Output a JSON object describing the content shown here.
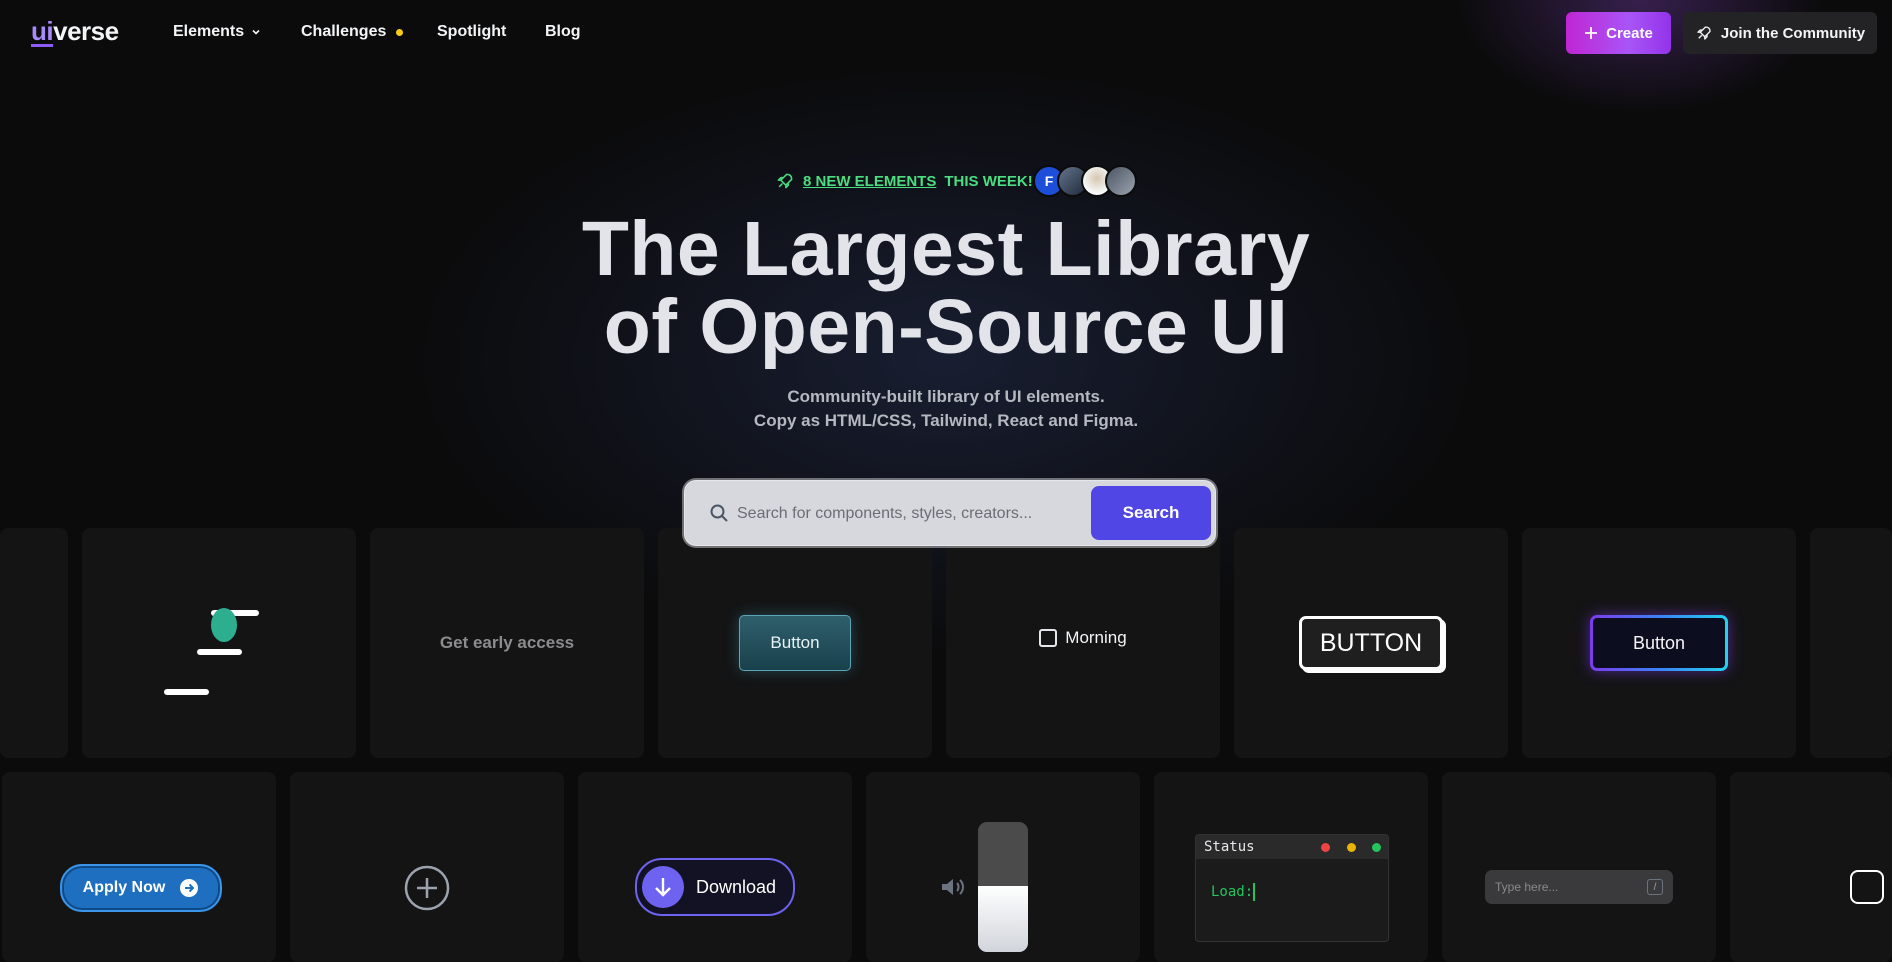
{
  "nav": {
    "logo": {
      "ui": "ui",
      "verse": "verse"
    },
    "links": [
      {
        "label": "Elements"
      },
      {
        "label": "Challenges"
      },
      {
        "label": "Spotlight"
      },
      {
        "label": "Blog"
      }
    ],
    "create_label": "Create",
    "join_label": "Join the Community"
  },
  "hero": {
    "announce_link": "8 NEW ELEMENTS",
    "announce_rest": "THIS WEEK!",
    "avatar_initial": "F",
    "title_line1": "The Largest Library",
    "title_line2": "of Open-Source UI",
    "subtitle_line1": "Community-built library of UI elements.",
    "subtitle_line2": "Copy as HTML/CSS, Tailwind, React and Figma."
  },
  "search": {
    "placeholder": "Search for components, styles, creators...",
    "button_label": "Search"
  },
  "cards": {
    "early_access": "Get early access",
    "button_glass": "Button",
    "checkbox_label": "Morning",
    "button_outline": "BUTTON",
    "button_gradient": "Button",
    "apply_now": "Apply Now",
    "download": "Download",
    "terminal_title": "Status",
    "terminal_text": "Load:",
    "type_placeholder": "Type here...",
    "type_shortcut": "/"
  },
  "colors": {
    "accent": "#4f46e5",
    "create_gradient_start": "#c026d3",
    "announce_green": "#4ade80",
    "challenge_dot": "#facc15"
  }
}
